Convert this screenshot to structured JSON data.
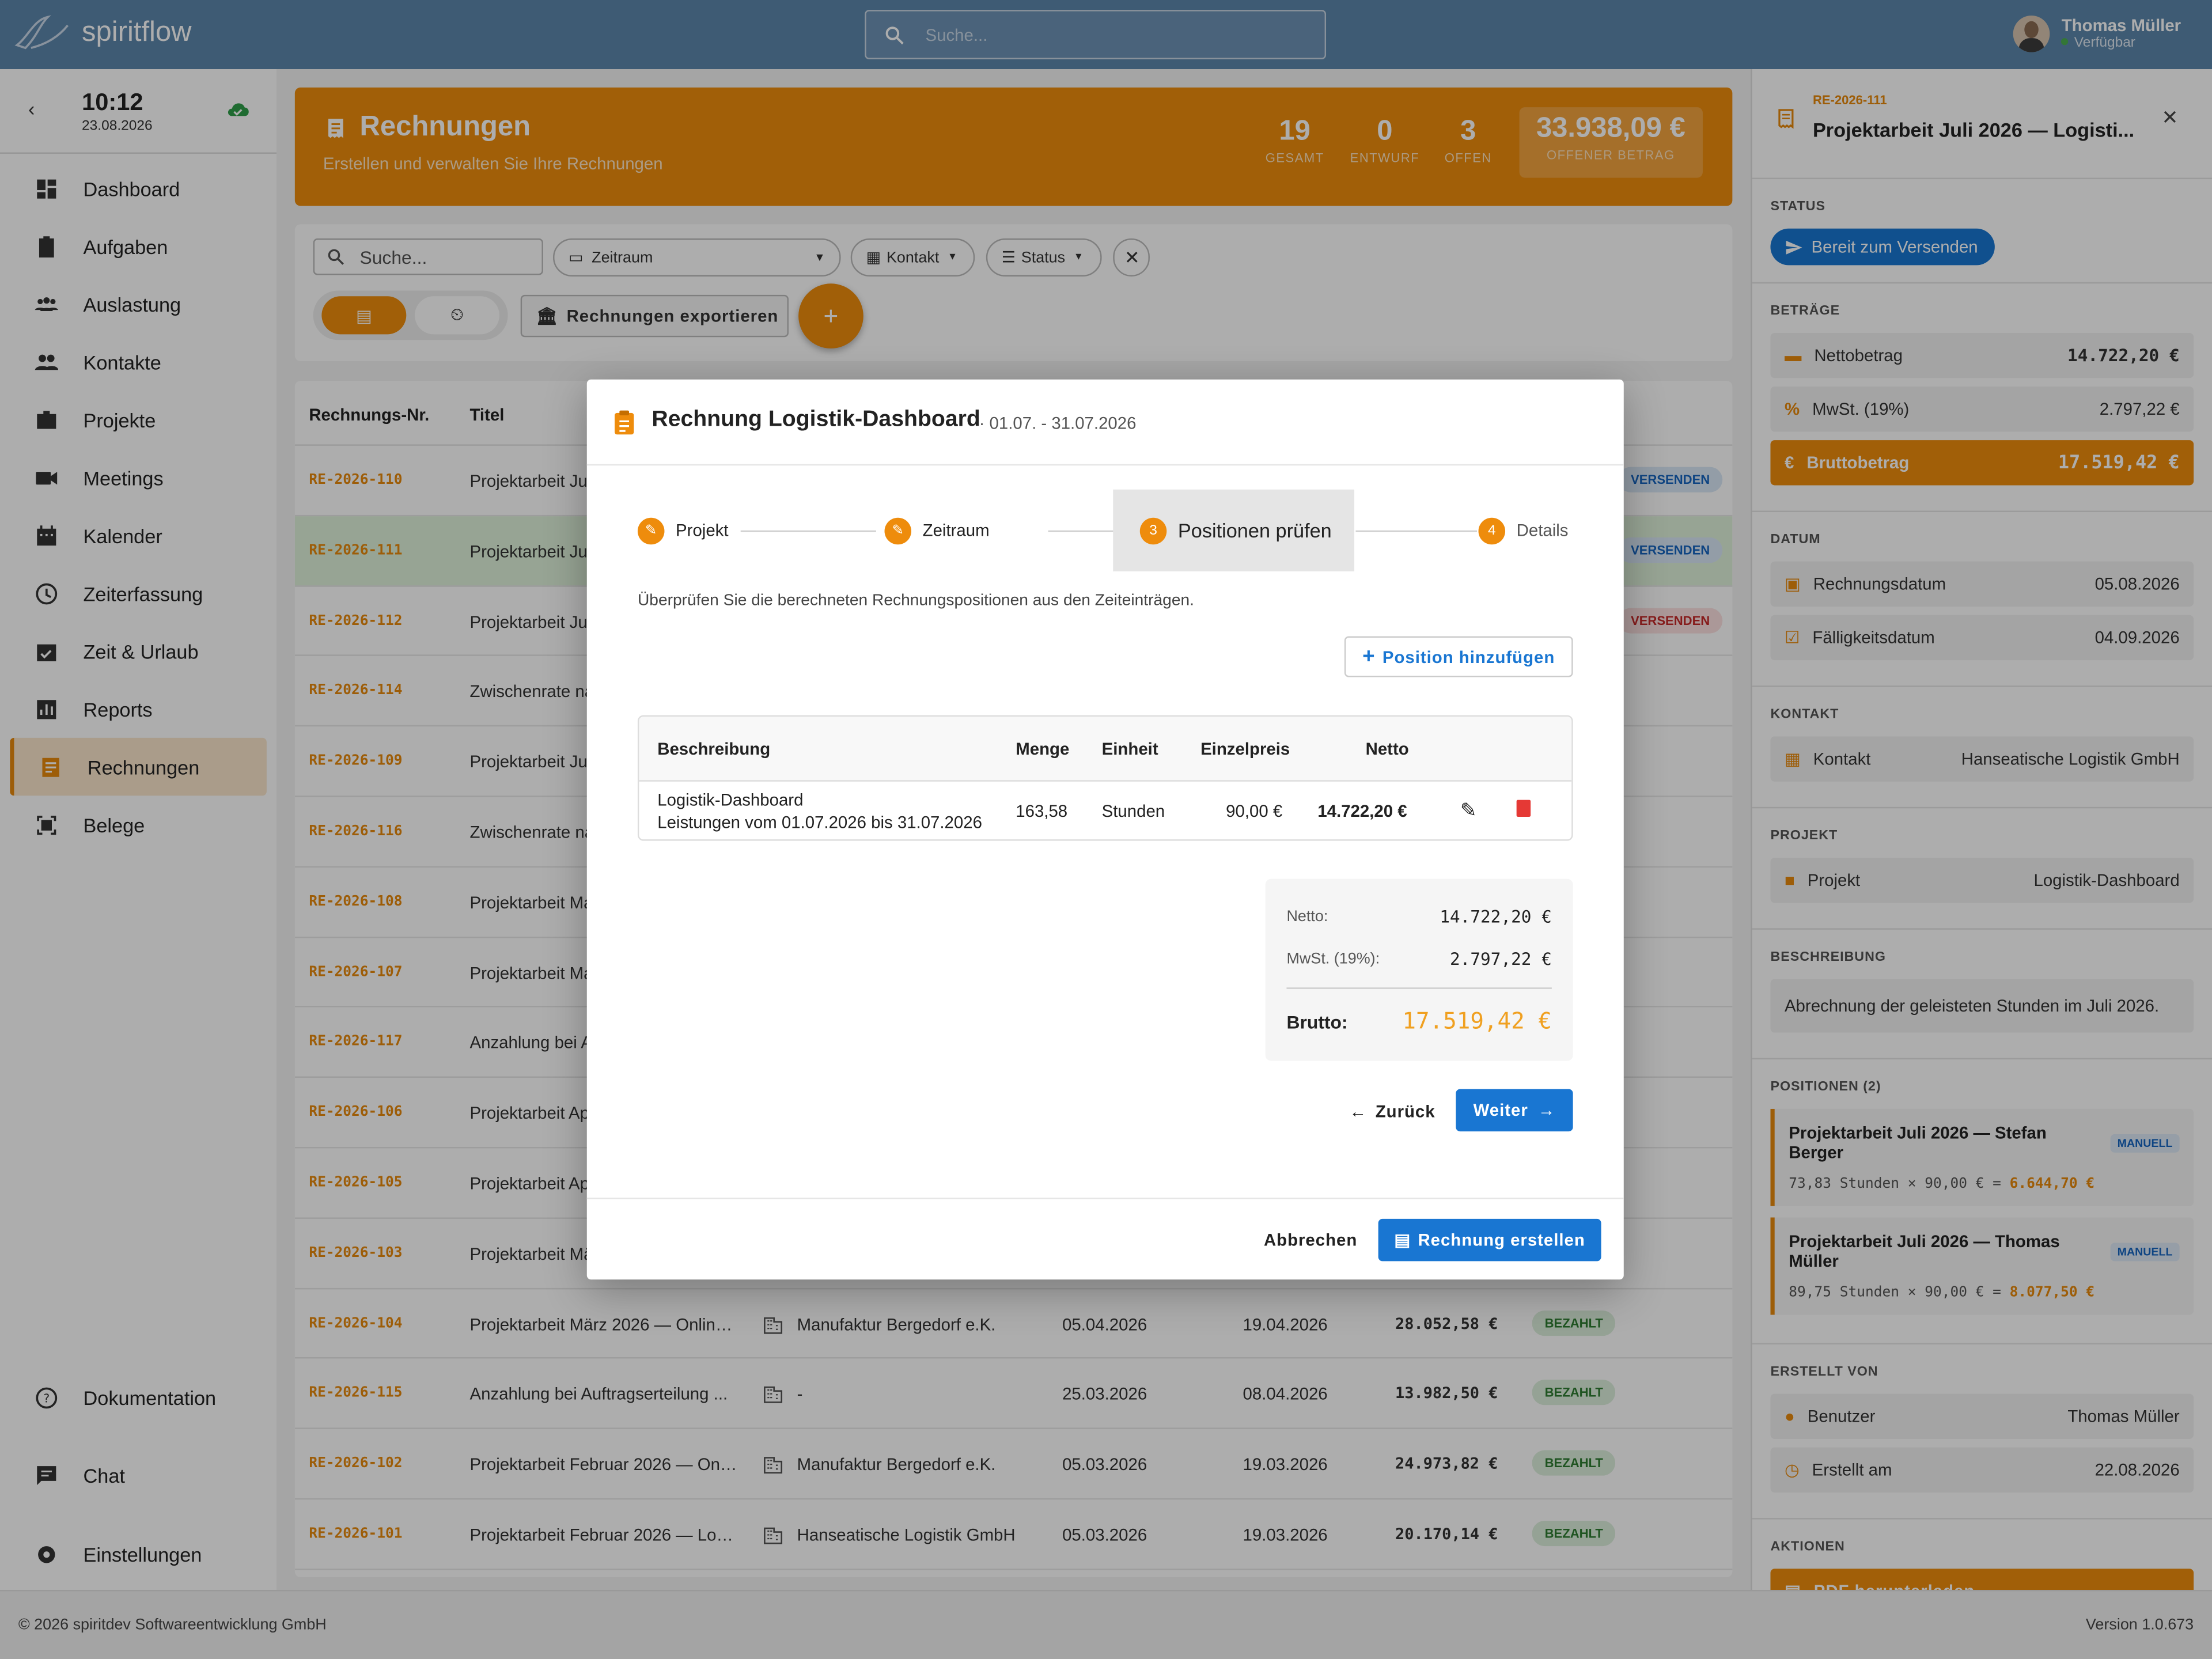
{
  "app": {
    "brand": "spiritflow",
    "search_placeholder": "Suche..."
  },
  "user": {
    "name": "Thomas Müller",
    "status": "Verfügbar"
  },
  "clock": {
    "time": "10:12",
    "date": "23.08.2026"
  },
  "sidebar": {
    "items": [
      {
        "label": "Dashboard",
        "icon": "dashboard-icon"
      },
      {
        "label": "Aufgaben",
        "icon": "clipboard-icon"
      },
      {
        "label": "Auslastung",
        "icon": "group-icon"
      },
      {
        "label": "Kontakte",
        "icon": "people-icon"
      },
      {
        "label": "Projekte",
        "icon": "briefcase-icon"
      },
      {
        "label": "Meetings",
        "icon": "videocam-icon"
      },
      {
        "label": "Kalender",
        "icon": "calendar-icon"
      },
      {
        "label": "Zeiterfassung",
        "icon": "clock-icon"
      },
      {
        "label": "Zeit & Urlaub",
        "icon": "event-check-icon"
      },
      {
        "label": "Reports",
        "icon": "bar-chart-icon"
      },
      {
        "label": "Rechnungen",
        "icon": "receipt-icon",
        "active": true
      },
      {
        "label": "Belege",
        "icon": "document-scan-icon"
      }
    ],
    "bottom": [
      {
        "label": "Dokumentation",
        "icon": "help-icon"
      },
      {
        "label": "Chat",
        "icon": "chat-icon"
      },
      {
        "label": "Einstellungen",
        "icon": "settings-icon"
      }
    ]
  },
  "hero": {
    "title": "Rechnungen",
    "subtitle": "Erstellen und verwalten Sie Ihre Rechnungen",
    "stats": [
      {
        "value": "19",
        "label": "GESAMT"
      },
      {
        "value": "0",
        "label": "ENTWURF"
      },
      {
        "value": "3",
        "label": "OFFEN"
      },
      {
        "value": "33.938,09 €",
        "label": "OFFENER BETRAG"
      }
    ]
  },
  "filters": {
    "search_placeholder": "Suche...",
    "zeitraum": "Zeitraum",
    "kontakt": "Kontakt",
    "status": "Status",
    "export": "Rechnungen exportieren"
  },
  "table": {
    "headers": {
      "nr": "Rechnungs-Nr.",
      "title": "Titel"
    },
    "rows": [
      {
        "nr": "RE-2026-110",
        "title": "Projektarbeit Ju",
        "badge": "VERSENDEN",
        "badge_type": "send"
      },
      {
        "nr": "RE-2026-111",
        "title": "Projektarbeit Ju",
        "badge": "VERSENDEN",
        "badge_type": "send",
        "selected": true
      },
      {
        "nr": "RE-2026-112",
        "title": "Projektarbeit Ju",
        "badge": "VERSENDEN",
        "badge_type": "red"
      },
      {
        "nr": "RE-2026-114",
        "title": "Zwischenrate na"
      },
      {
        "nr": "RE-2026-109",
        "title": "Projektarbeit Ju"
      },
      {
        "nr": "RE-2026-116",
        "title": "Zwischenrate na"
      },
      {
        "nr": "RE-2026-108",
        "title": "Projektarbeit Ma"
      },
      {
        "nr": "RE-2026-107",
        "title": "Projektarbeit Ma"
      },
      {
        "nr": "RE-2026-117",
        "title": "Anzahlung bei A"
      },
      {
        "nr": "RE-2026-106",
        "title": "Projektarbeit Ap"
      },
      {
        "nr": "RE-2026-105",
        "title": "Projektarbeit Ap"
      },
      {
        "nr": "RE-2026-103",
        "title": "Projektarbeit Mä"
      },
      {
        "nr": "RE-2026-104",
        "title": "Projektarbeit März 2026 — Online...",
        "contact": "Manufaktur Bergedorf e.K.",
        "date": "05.04.2026",
        "due": "19.04.2026",
        "amount": "28.052,58 €",
        "badge": "BEZAHLT",
        "badge_type": "paid"
      },
      {
        "nr": "RE-2026-115",
        "title": "Anzahlung bei Auftragserteilung ...",
        "contact": "-",
        "date": "25.03.2026",
        "due": "08.04.2026",
        "amount": "13.982,50 €",
        "badge": "BEZAHLT",
        "badge_type": "paid"
      },
      {
        "nr": "RE-2026-102",
        "title": "Projektarbeit Februar 2026 — Onli...",
        "contact": "Manufaktur Bergedorf e.K.",
        "date": "05.03.2026",
        "due": "19.03.2026",
        "amount": "24.973,82 €",
        "badge": "BEZAHLT",
        "badge_type": "paid"
      },
      {
        "nr": "RE-2026-101",
        "title": "Projektarbeit Februar 2026 — Logi...",
        "contact": "Hanseatische Logistik GmbH",
        "date": "05.03.2026",
        "due": "19.03.2026",
        "amount": "20.170,14 €",
        "badge": "BEZAHLT",
        "badge_type": "paid"
      }
    ]
  },
  "modal": {
    "title": "Rechnung Logistik-Dashboard",
    "range": "· 01.07. - 31.07.2026",
    "steps": [
      {
        "label": "Projekt",
        "num": ""
      },
      {
        "label": "Zeitraum",
        "num": ""
      },
      {
        "label": "Positionen prüfen",
        "num": "3"
      },
      {
        "label": "Details",
        "num": "4"
      }
    ],
    "instruction": "Überprüfen Sie die berechneten Rechnungspositionen aus den Zeiteinträgen.",
    "add_position": "Position hinzufügen",
    "columns": {
      "desc": "Beschreibung",
      "qty": "Menge",
      "unit": "Einheit",
      "price": "Einzelpreis",
      "net": "Netto"
    },
    "row": {
      "desc1": "Logistik-Dashboard",
      "desc2": "Leistungen vom 01.07.2026 bis 31.07.2026",
      "qty": "163,58",
      "unit": "Stunden",
      "price": "90,00 €",
      "net": "14.722,20 €"
    },
    "totals": {
      "netto_label": "Netto:",
      "netto": "14.722,20 €",
      "mwst_label": "MwSt. (19%):",
      "mwst": "2.797,22 €",
      "brutto_label": "Brutto:",
      "brutto": "17.519,42 €"
    },
    "back": "Zurück",
    "next": "Weiter",
    "cancel": "Abbrechen",
    "create": "Rechnung erstellen"
  },
  "detail": {
    "nr": "RE-2026-111",
    "title": "Projektarbeit Juli 2026 — Logisti...",
    "status_label": "STATUS",
    "status": "Bereit zum Versenden",
    "betraege_label": "BETRÄGE",
    "netto_label": "Nettobetrag",
    "netto": "14.722,20 €",
    "mwst_label": "MwSt. (19%)",
    "mwst": "2.797,22 €",
    "brutto_label": "Bruttobetrag",
    "brutto": "17.519,42 €",
    "datum_label": "DATUM",
    "rdatum_label": "Rechnungsdatum",
    "rdatum": "05.08.2026",
    "fdatum_label": "Fälligkeitsdatum",
    "fdatum": "04.09.2026",
    "kontakt_section": "KONTAKT",
    "kontakt_label": "Kontakt",
    "kontakt": "Hanseatische Logistik GmbH",
    "projekt_section": "PROJEKT",
    "projekt_label": "Projekt",
    "projekt": "Logistik-Dashboard",
    "beschreibung_section": "BESCHREIBUNG",
    "beschreibung": "Abrechnung der geleisteten Stunden im Juli 2026.",
    "positionen_section": "POSITIONEN (2)",
    "positionen": [
      {
        "title": "Projektarbeit Juli 2026 — Stefan Berger",
        "tag": "MANUELL",
        "calc": "73,83 Stunden × 90,00 € = ",
        "sum": "6.644,70 €"
      },
      {
        "title": "Projektarbeit Juli 2026 — Thomas Müller",
        "tag": "MANUELL",
        "calc": "89,75 Stunden × 90,00 € = ",
        "sum": "8.077,50 €"
      }
    ],
    "erstellt_section": "ERSTELLT VON",
    "benutzer_label": "Benutzer",
    "benutzer": "Thomas Müller",
    "erstellt_label": "Erstellt am",
    "erstellt": "22.08.2026",
    "aktionen_section": "AKTIONEN",
    "pdf": "PDF herunterladen"
  },
  "footer": {
    "copyright": "© 2026 spiritdev Softwareentwicklung GmbH",
    "version": "Version 1.0.673"
  },
  "colors": {
    "accent": "#ee8c0c",
    "topbar": "#5c86ac",
    "primary": "#1976d2"
  }
}
